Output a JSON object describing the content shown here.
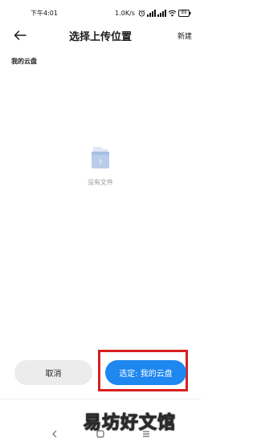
{
  "status_bar": {
    "time": "下午4:01",
    "network_speed": "1.0K/s",
    "battery": "89",
    "icons": [
      "alarm-icon",
      "signal-icon",
      "signal-icon",
      "wifi-icon",
      "battery-icon"
    ]
  },
  "header": {
    "title": "选择上传位置",
    "new_label": "新建",
    "back_icon": "back-arrow-icon"
  },
  "breadcrumb": {
    "current_folder": "我的云盘"
  },
  "empty_state": {
    "icon": "empty-folder-icon",
    "text": "没有文件"
  },
  "actions": {
    "cancel_label": "取消",
    "confirm_label": "选定: 我的云盘",
    "highlight_color": "#d81f1f",
    "confirm_color": "#1e87f0"
  },
  "watermark": {
    "text": "易坊好文馆"
  }
}
